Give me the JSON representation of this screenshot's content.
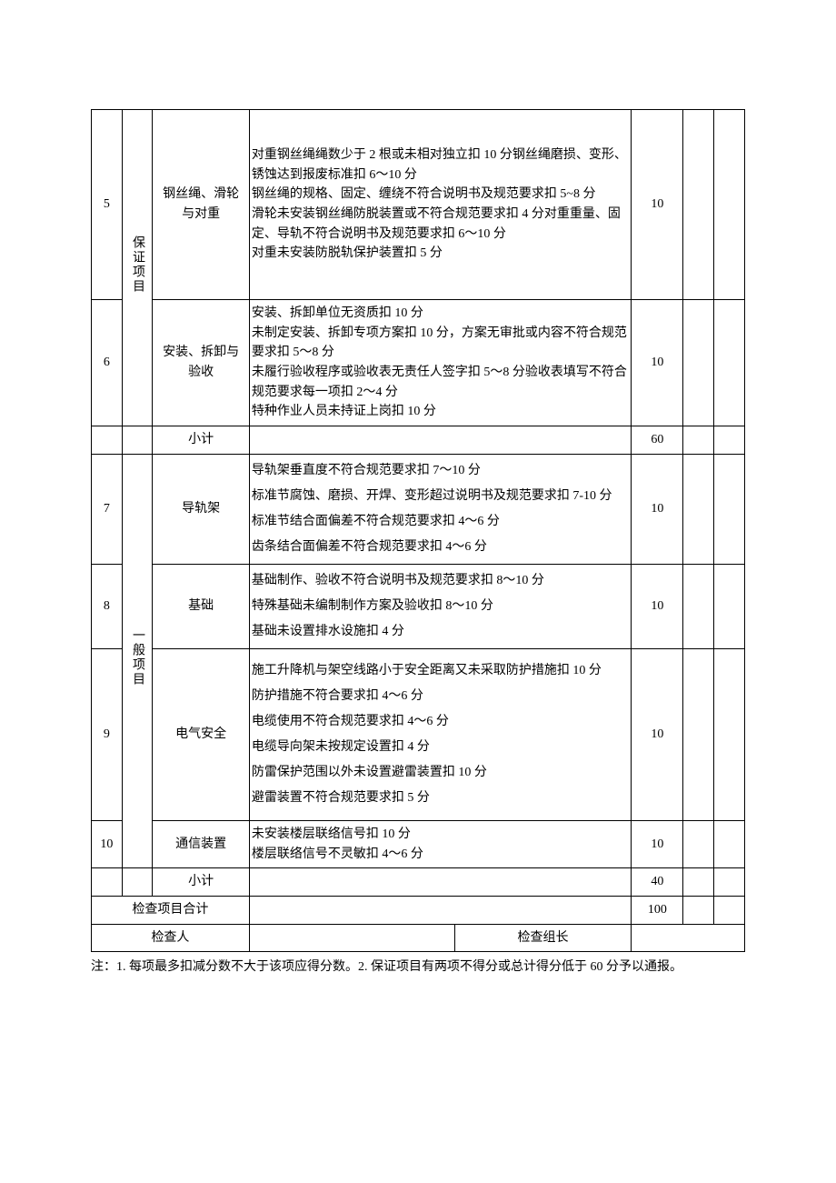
{
  "rows": {
    "r5": {
      "num": "5",
      "item": "钢丝绳、滑轮与对重",
      "desc_lines": [
        "对重钢丝绳绳数少于 2 根或未相对独立扣 10 分钢丝绳磨损、变形、锈蚀达到报废标准扣 6～10 分",
        "钢丝绳的规格、固定、缠绕不符合说明书及规范要求扣 5~8 分",
        "滑轮未安装钢丝绳防脱装置或不符合规范要求扣 4 分对重重量、固定、导轨不符合说明书及规范要求扣 6～10 分",
        "对重未安装防脱轨保护装置扣 5 分"
      ],
      "score": "10"
    },
    "r6": {
      "num": "6",
      "cat": "保证项目",
      "item": "安装、拆卸与验收",
      "desc_lines": [
        "安装、拆卸单位无资质扣 10 分",
        "未制定安装、拆卸专项方案扣 10 分，方案无审批或内容不符合规范要求扣 5～8 分",
        "未履行验收程序或验收表无责任人签字扣 5～8 分验收表填写不符合规范要求每一项扣 2～4 分",
        "特种作业人员未持证上岗扣 10 分"
      ],
      "score": "10"
    },
    "subtotal1": {
      "label": "小计",
      "value": "60"
    },
    "r7": {
      "num": "7",
      "cat": "一般项目",
      "item": "导轨架",
      "desc_lines": [
        "导轨架垂直度不符合规范要求扣 7～10 分",
        "标准节腐蚀、磨损、开焊、变形超过说明书及规范要求扣 7-10 分",
        "标准节结合面偏差不符合规范要求扣 4～6 分",
        "齿条结合面偏差不符合规范要求扣 4～6 分"
      ],
      "score": "10"
    },
    "r8": {
      "num": "8",
      "item": "基础",
      "desc_lines": [
        "基础制作、验收不符合说明书及规范要求扣 8～10 分",
        "特殊基础未编制制作方案及验收扣 8～10 分",
        "基础未设置排水设施扣 4 分"
      ],
      "score": "10"
    },
    "r9": {
      "num": "9",
      "item": "电气安全",
      "desc_lines": [
        "施工升降机与架空线路小于安全距离又未采取防护措施扣 10 分",
        "防护措施不符合要求扣 4～6 分",
        "电缆使用不符合规范要求扣 4～6 分",
        "电缆导向架未按规定设置扣 4 分",
        "防雷保护范围以外未设置避雷装置扣 10 分",
        "避雷装置不符合规范要求扣 5 分"
      ],
      "score": "10"
    },
    "r10": {
      "num": "10",
      "item": "通信装置",
      "desc_lines": [
        "未安装楼层联络信号扣 10 分",
        "楼层联络信号不灵敏扣 4～6 分"
      ],
      "score": "10"
    },
    "subtotal2": {
      "label": "小计",
      "value": "40"
    },
    "total": {
      "label": "检查项目合计",
      "value": "100"
    },
    "inspector_label": "检查人",
    "teamlead_label": "检查组长"
  },
  "footnote": "注：1. 每项最多扣减分数不大于该项应得分数。2. 保证项目有两项不得分或总计得分低于 60 分予以通报。"
}
